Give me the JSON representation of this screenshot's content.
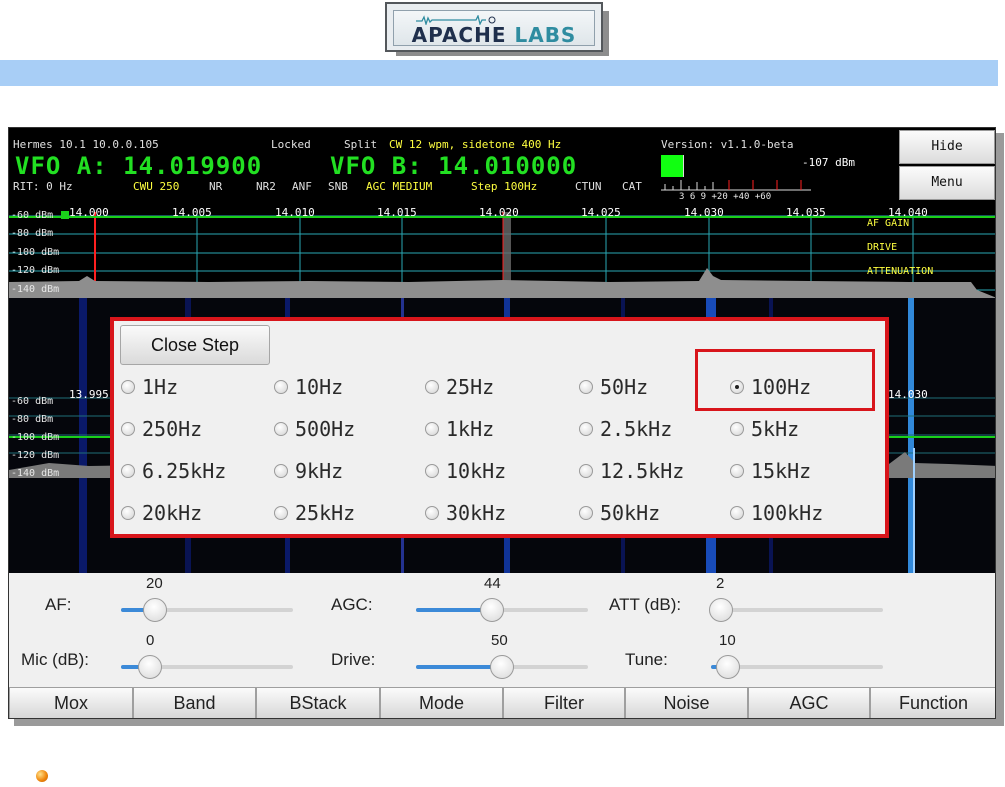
{
  "header": {
    "logo_main": "APACHE",
    "logo_accent": "LABS"
  },
  "status": {
    "device": "Hermes 10.1 10.0.0.105",
    "locked": "Locked",
    "split": "Split",
    "cw_info": "CW 12 wpm, sidetone 400 Hz",
    "version": "Version: v1.1.0-beta",
    "vfo_a": "VFO A: 14.019900",
    "vfo_b": "VFO B: 14.010000",
    "signal": "-107 dBm",
    "rit": "RIT: 0 Hz",
    "mode_filter": "CWU 250",
    "nr": "NR",
    "nr2": "NR2",
    "anf": "ANF",
    "snb": "SNB",
    "agc": "AGC MEDIUM",
    "step": "Step 100Hz",
    "ctun": "CTUN",
    "cat": "CAT",
    "meter_scale": "3  6  9 +20 +40 +60",
    "meter_level": 0.28
  },
  "side_buttons": {
    "hide": "Hide",
    "menu": "Menu"
  },
  "spectrum": {
    "freq_labels": [
      "14.000",
      "14.005",
      "14.010",
      "14.015",
      "14.020",
      "14.025",
      "14.030",
      "14.035",
      "14.040"
    ],
    "db_labels": [
      "-60 dBm",
      "-80 dBm",
      "-100 dBm",
      "-120 dBm",
      "-140 dBm"
    ],
    "right_labels": [
      "AF GAIN",
      "DRIVE",
      "ATTENUATION"
    ],
    "sub_left_freq": "13.995",
    "sub_right_freq": "14.030",
    "sub_db_labels": [
      "-60 dBm",
      "-80 dBm",
      "-100 dBm",
      "-120 dBm",
      "-140 dBm"
    ]
  },
  "step_dialog": {
    "close_label": "Close Step",
    "selected": "100Hz",
    "options": [
      [
        "1Hz",
        "10Hz",
        "25Hz",
        "50Hz",
        "100Hz"
      ],
      [
        "250Hz",
        "500Hz",
        "1kHz",
        "2.5kHz",
        "5kHz"
      ],
      [
        "6.25kHz",
        "9kHz",
        "10kHz",
        "12.5kHz",
        "15kHz"
      ],
      [
        "20kHz",
        "25kHz",
        "30kHz",
        "50kHz",
        "100kHz"
      ]
    ]
  },
  "controls": {
    "af": {
      "label": "AF:",
      "value": "20",
      "level": 0.2
    },
    "agc": {
      "label": "AGC:",
      "value": "44",
      "level": 0.44
    },
    "att": {
      "label": "ATT (dB):",
      "value": "2",
      "level": 0.06
    },
    "mic": {
      "label": "Mic (dB):",
      "value": "0",
      "level": 0.17
    },
    "drive": {
      "label": "Drive:",
      "value": "50",
      "level": 0.5
    },
    "tune": {
      "label": "Tune:",
      "value": "10",
      "level": 0.1
    }
  },
  "bottom_buttons": [
    "Mox",
    "Band",
    "BStack",
    "Mode",
    "Filter",
    "Noise",
    "AGC",
    "Function"
  ],
  "colors": {
    "accent": "#3c8ad8",
    "highlight": "#d8151b",
    "vfo_green": "#22e022",
    "status_yellow": "#ffff40",
    "band_blue": "#a8cef6"
  }
}
